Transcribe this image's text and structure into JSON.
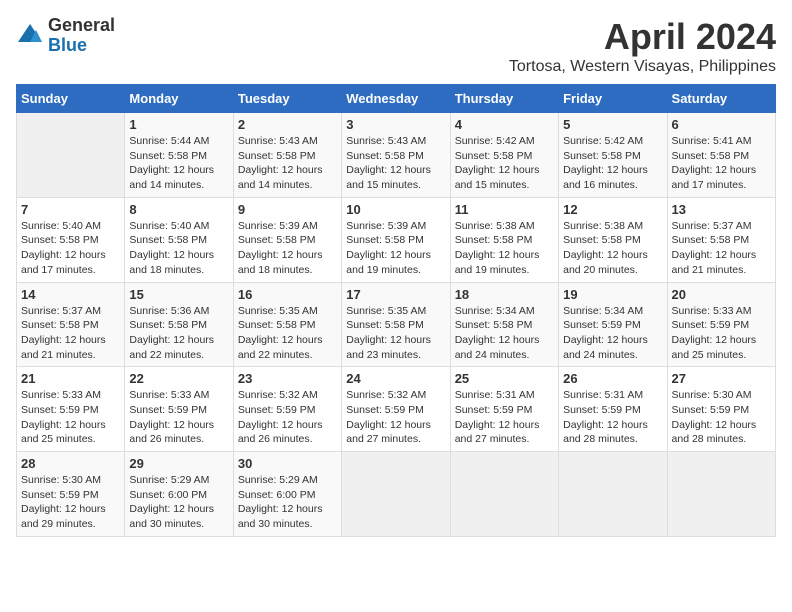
{
  "logo": {
    "general": "General",
    "blue": "Blue"
  },
  "title": "April 2024",
  "location": "Tortosa, Western Visayas, Philippines",
  "headers": [
    "Sunday",
    "Monday",
    "Tuesday",
    "Wednesday",
    "Thursday",
    "Friday",
    "Saturday"
  ],
  "weeks": [
    [
      {
        "day": "",
        "info": ""
      },
      {
        "day": "1",
        "info": "Sunrise: 5:44 AM\nSunset: 5:58 PM\nDaylight: 12 hours\nand 14 minutes."
      },
      {
        "day": "2",
        "info": "Sunrise: 5:43 AM\nSunset: 5:58 PM\nDaylight: 12 hours\nand 14 minutes."
      },
      {
        "day": "3",
        "info": "Sunrise: 5:43 AM\nSunset: 5:58 PM\nDaylight: 12 hours\nand 15 minutes."
      },
      {
        "day": "4",
        "info": "Sunrise: 5:42 AM\nSunset: 5:58 PM\nDaylight: 12 hours\nand 15 minutes."
      },
      {
        "day": "5",
        "info": "Sunrise: 5:42 AM\nSunset: 5:58 PM\nDaylight: 12 hours\nand 16 minutes."
      },
      {
        "day": "6",
        "info": "Sunrise: 5:41 AM\nSunset: 5:58 PM\nDaylight: 12 hours\nand 17 minutes."
      }
    ],
    [
      {
        "day": "7",
        "info": "Sunrise: 5:40 AM\nSunset: 5:58 PM\nDaylight: 12 hours\nand 17 minutes."
      },
      {
        "day": "8",
        "info": "Sunrise: 5:40 AM\nSunset: 5:58 PM\nDaylight: 12 hours\nand 18 minutes."
      },
      {
        "day": "9",
        "info": "Sunrise: 5:39 AM\nSunset: 5:58 PM\nDaylight: 12 hours\nand 18 minutes."
      },
      {
        "day": "10",
        "info": "Sunrise: 5:39 AM\nSunset: 5:58 PM\nDaylight: 12 hours\nand 19 minutes."
      },
      {
        "day": "11",
        "info": "Sunrise: 5:38 AM\nSunset: 5:58 PM\nDaylight: 12 hours\nand 19 minutes."
      },
      {
        "day": "12",
        "info": "Sunrise: 5:38 AM\nSunset: 5:58 PM\nDaylight: 12 hours\nand 20 minutes."
      },
      {
        "day": "13",
        "info": "Sunrise: 5:37 AM\nSunset: 5:58 PM\nDaylight: 12 hours\nand 21 minutes."
      }
    ],
    [
      {
        "day": "14",
        "info": "Sunrise: 5:37 AM\nSunset: 5:58 PM\nDaylight: 12 hours\nand 21 minutes."
      },
      {
        "day": "15",
        "info": "Sunrise: 5:36 AM\nSunset: 5:58 PM\nDaylight: 12 hours\nand 22 minutes."
      },
      {
        "day": "16",
        "info": "Sunrise: 5:35 AM\nSunset: 5:58 PM\nDaylight: 12 hours\nand 22 minutes."
      },
      {
        "day": "17",
        "info": "Sunrise: 5:35 AM\nSunset: 5:58 PM\nDaylight: 12 hours\nand 23 minutes."
      },
      {
        "day": "18",
        "info": "Sunrise: 5:34 AM\nSunset: 5:58 PM\nDaylight: 12 hours\nand 24 minutes."
      },
      {
        "day": "19",
        "info": "Sunrise: 5:34 AM\nSunset: 5:59 PM\nDaylight: 12 hours\nand 24 minutes."
      },
      {
        "day": "20",
        "info": "Sunrise: 5:33 AM\nSunset: 5:59 PM\nDaylight: 12 hours\nand 25 minutes."
      }
    ],
    [
      {
        "day": "21",
        "info": "Sunrise: 5:33 AM\nSunset: 5:59 PM\nDaylight: 12 hours\nand 25 minutes."
      },
      {
        "day": "22",
        "info": "Sunrise: 5:33 AM\nSunset: 5:59 PM\nDaylight: 12 hours\nand 26 minutes."
      },
      {
        "day": "23",
        "info": "Sunrise: 5:32 AM\nSunset: 5:59 PM\nDaylight: 12 hours\nand 26 minutes."
      },
      {
        "day": "24",
        "info": "Sunrise: 5:32 AM\nSunset: 5:59 PM\nDaylight: 12 hours\nand 27 minutes."
      },
      {
        "day": "25",
        "info": "Sunrise: 5:31 AM\nSunset: 5:59 PM\nDaylight: 12 hours\nand 27 minutes."
      },
      {
        "day": "26",
        "info": "Sunrise: 5:31 AM\nSunset: 5:59 PM\nDaylight: 12 hours\nand 28 minutes."
      },
      {
        "day": "27",
        "info": "Sunrise: 5:30 AM\nSunset: 5:59 PM\nDaylight: 12 hours\nand 28 minutes."
      }
    ],
    [
      {
        "day": "28",
        "info": "Sunrise: 5:30 AM\nSunset: 5:59 PM\nDaylight: 12 hours\nand 29 minutes."
      },
      {
        "day": "29",
        "info": "Sunrise: 5:29 AM\nSunset: 6:00 PM\nDaylight: 12 hours\nand 30 minutes."
      },
      {
        "day": "30",
        "info": "Sunrise: 5:29 AM\nSunset: 6:00 PM\nDaylight: 12 hours\nand 30 minutes."
      },
      {
        "day": "",
        "info": ""
      },
      {
        "day": "",
        "info": ""
      },
      {
        "day": "",
        "info": ""
      },
      {
        "day": "",
        "info": ""
      }
    ]
  ]
}
